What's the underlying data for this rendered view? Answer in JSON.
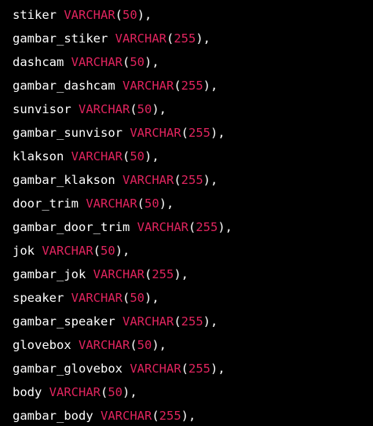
{
  "code": {
    "lines": [
      {
        "name": "stiker",
        "type": "VARCHAR",
        "size": "50",
        "trail": "),"
      },
      {
        "name": "gambar_stiker",
        "type": "VARCHAR",
        "size": "255",
        "trail": "),"
      },
      {
        "name": "dashcam",
        "type": "VARCHAR",
        "size": "50",
        "trail": "),"
      },
      {
        "name": "gambar_dashcam",
        "type": "VARCHAR",
        "size": "255",
        "trail": "),"
      },
      {
        "name": "sunvisor",
        "type": "VARCHAR",
        "size": "50",
        "trail": "),"
      },
      {
        "name": "gambar_sunvisor",
        "type": "VARCHAR",
        "size": "255",
        "trail": "),"
      },
      {
        "name": "klakson",
        "type": "VARCHAR",
        "size": "50",
        "trail": "),"
      },
      {
        "name": "gambar_klakson",
        "type": "VARCHAR",
        "size": "255",
        "trail": "),"
      },
      {
        "name": "door_trim",
        "type": "VARCHAR",
        "size": "50",
        "trail": "),"
      },
      {
        "name": "gambar_door_trim",
        "type": "VARCHAR",
        "size": "255",
        "trail": "),"
      },
      {
        "name": "jok",
        "type": "VARCHAR",
        "size": "50",
        "trail": "),"
      },
      {
        "name": "gambar_jok",
        "type": "VARCHAR",
        "size": "255",
        "trail": "),"
      },
      {
        "name": "speaker",
        "type": "VARCHAR",
        "size": "50",
        "trail": "),"
      },
      {
        "name": "gambar_speaker",
        "type": "VARCHAR",
        "size": "255",
        "trail": "),"
      },
      {
        "name": "glovebox",
        "type": "VARCHAR",
        "size": "50",
        "trail": "),"
      },
      {
        "name": "gambar_glovebox",
        "type": "VARCHAR",
        "size": "255",
        "trail": "),"
      },
      {
        "name": "body",
        "type": "VARCHAR",
        "size": "50",
        "trail": "),"
      },
      {
        "name": "gambar_body",
        "type": "VARCHAR",
        "size": "255",
        "trail": "),"
      }
    ]
  },
  "colors": {
    "background": "#000000",
    "identifier": "#ffffff",
    "keyword": "#e0245e",
    "number": "#e0245e"
  }
}
